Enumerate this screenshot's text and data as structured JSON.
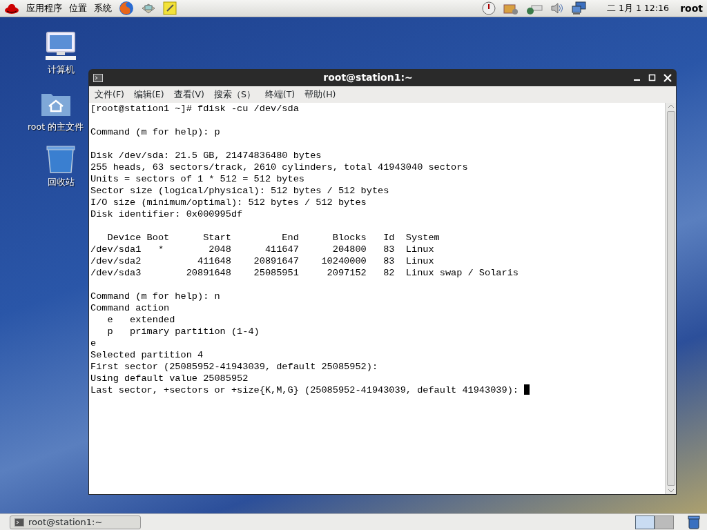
{
  "top_panel": {
    "menus": [
      "应用程序",
      "位置",
      "系统"
    ],
    "clock": "二 1月  1 12:16",
    "user": "root"
  },
  "desktop_icons": [
    {
      "kind": "computer",
      "label": "计算机"
    },
    {
      "kind": "home",
      "label": "root 的主文件"
    },
    {
      "kind": "trash",
      "label": "回收站"
    }
  ],
  "window": {
    "title": "root@station1:~",
    "menu": [
      "文件(F)",
      "编辑(E)",
      "查看(V)",
      "搜索（S）",
      "终端(T)",
      "帮助(H)"
    ],
    "blocks": [
      [
        "[root@station1 ~]# fdisk -cu /dev/sda"
      ],
      [
        "Command (m for help): p"
      ],
      [
        "Disk /dev/sda: 21.5 GB, 21474836480 bytes",
        "255 heads, 63 sectors/track, 2610 cylinders, total 41943040 sectors",
        "Units = sectors of 1 * 512 = 512 bytes",
        "Sector size (logical/physical): 512 bytes / 512 bytes",
        "I/O size (minimum/optimal): 512 bytes / 512 bytes",
        "Disk identifier: 0x000995df"
      ],
      [
        "   Device Boot      Start         End      Blocks   Id  System",
        "/dev/sda1   *        2048      411647      204800   83  Linux",
        "/dev/sda2          411648    20891647    10240000   83  Linux",
        "/dev/sda3        20891648    25085951     2097152   82  Linux swap / Solaris"
      ],
      [
        "Command (m for help): n",
        "Command action",
        "   e   extended",
        "   p   primary partition (1-4)",
        "e",
        "Selected partition 4",
        "First sector (25085952-41943039, default 25085952):",
        "Using default value 25085952",
        "Last sector, +sectors or +size{K,M,G} (25085952-41943039, default 41943039): "
      ]
    ],
    "cursor": true
  },
  "taskbar": {
    "tasks": [
      {
        "label": "root@station1:~",
        "selected": false
      }
    ],
    "workspaces": [
      {
        "selected": true
      },
      {
        "selected": false
      }
    ]
  }
}
